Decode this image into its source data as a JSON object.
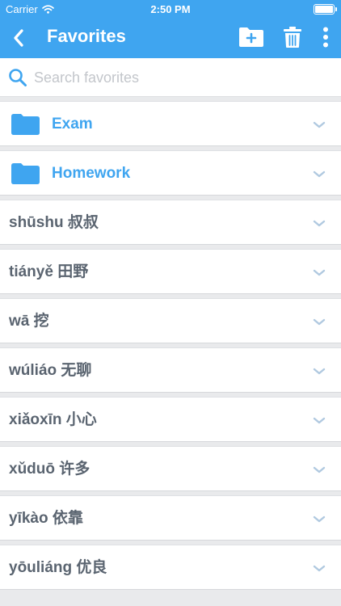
{
  "status_bar": {
    "carrier": "Carrier",
    "time": "2:50 PM",
    "battery_level": 1.0
  },
  "header": {
    "title": "Favorites",
    "back_icon": "chevron-left-icon",
    "actions": [
      {
        "name": "new-folder-button",
        "icon": "folder-plus-icon"
      },
      {
        "name": "delete-button",
        "icon": "trash-icon"
      },
      {
        "name": "more-options-button",
        "icon": "more-vertical-icon"
      }
    ]
  },
  "search": {
    "placeholder": "Search favorites",
    "value": ""
  },
  "folders": [
    {
      "label": "Exam"
    },
    {
      "label": "Homework"
    }
  ],
  "words": [
    {
      "label": "shūshu 叔叔"
    },
    {
      "label": "tiányě 田野"
    },
    {
      "label": "wā 挖"
    },
    {
      "label": "wúliáo 无聊"
    },
    {
      "label": "xiǎoxīn 小心"
    },
    {
      "label": "xǔduō 许多"
    },
    {
      "label": "yīkào 依靠"
    },
    {
      "label": "yōuliáng 优良"
    }
  ],
  "colors": {
    "accent": "#3fa5f0",
    "word_text": "#5a6470",
    "chevron": "#b0c9e0",
    "background": "#e9eaec",
    "placeholder": "#c3c6cb"
  }
}
